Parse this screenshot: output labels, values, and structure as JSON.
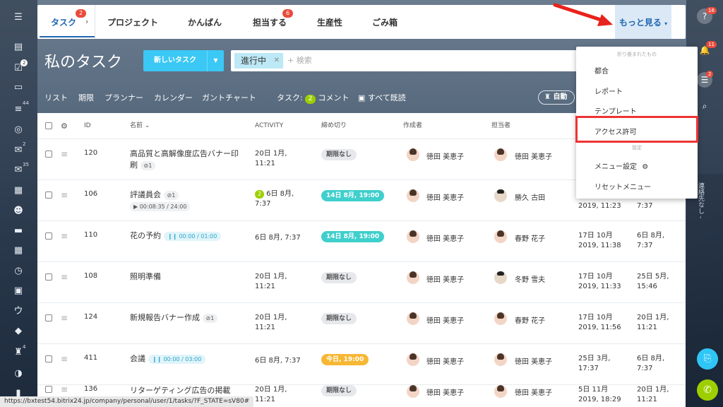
{
  "topnav": {
    "tabs": [
      {
        "label": "タスク",
        "badge": "2"
      },
      {
        "label": "プロジェクト"
      },
      {
        "label": "かんばん"
      },
      {
        "label": "担当する",
        "badge": "6"
      },
      {
        "label": "生産性"
      },
      {
        "label": "ごみ箱"
      }
    ],
    "more": "もっと見る"
  },
  "left_sidebar_badges": {
    "tasks": "2",
    "feed": "44",
    "chat": "2",
    "mail": "35",
    "bot": "4"
  },
  "right_sidebar_badges": {
    "help": "16",
    "notify": "11",
    "messages": "2"
  },
  "right_vertical_text": "連絡先なし -",
  "page_title": "私のタスク",
  "new_task_button": "新しいタスク",
  "filter": {
    "chip": "進行中",
    "placeholder": "+ 検索"
  },
  "views": {
    "items": [
      "リスト",
      "期限",
      "プランナー",
      "カレンダー",
      "ガントチャート"
    ],
    "tasks_label": "タスク:",
    "count": "2",
    "comments": "コメント",
    "read_all": "すべて既読",
    "auto": "自動"
  },
  "table": {
    "headers": {
      "id": "ID",
      "name": "名前",
      "activity": "ACTIVITY",
      "deadline": "締め切り",
      "creator": "作成者",
      "assignee": "担当者"
    },
    "rows": [
      {
        "id": "120",
        "name": "高品質と高解像度広告バナー印刷",
        "attach": "1",
        "act": "",
        "activity": "20日 1月,\n11:21",
        "deadline": "期限なし",
        "dl_style": "none",
        "creator": "徳田 美恵子",
        "assignee": "徳田 美恵子",
        "c1": "",
        "c2": ""
      },
      {
        "id": "106",
        "name": "評議員会",
        "attach": "1",
        "timer": "00:08:35 / 24:00",
        "act": "2",
        "activity": "6日 8月,\n7:37",
        "deadline": "14日 8月, 19:00",
        "dl_style": "teal",
        "creator": "徳田 美恵子",
        "assignee": "勝久 古田",
        "c1": "2019, 11:23",
        "c2": "7:37"
      },
      {
        "id": "110",
        "name": "花の予約",
        "timer": "00:00 / 01:00",
        "act": "",
        "activity": "6日 8月, 7:37",
        "deadline": "14日 8月, 19:00",
        "dl_style": "teal",
        "creator": "徳田 美恵子",
        "assignee": "春野 花子",
        "c1": "17日 10月\n2019, 11:38",
        "c2": "6日 8月,\n7:37"
      },
      {
        "id": "108",
        "name": "照明準備",
        "act": "",
        "activity": "20日 1月,\n11:21",
        "deadline": "期限なし",
        "dl_style": "none",
        "creator": "徳田 美恵子",
        "assignee": "冬野 雪夫",
        "c1": "17日 10月\n2019, 11:33",
        "c2": "25日 5月,\n15:46"
      },
      {
        "id": "124",
        "name": "新規報告バナー作成",
        "attach": "1",
        "act": "",
        "activity": "20日 1月,\n11:21",
        "deadline": "期限なし",
        "dl_style": "none",
        "creator": "徳田 美恵子",
        "assignee": "春野 花子",
        "c1": "17日 10月\n2019, 11:56",
        "c2": "20日 1月,\n11:21"
      },
      {
        "id": "411",
        "name": "会議",
        "timer": "00:00 / 03:00",
        "act": "",
        "activity": "6日 8月, 7:37",
        "deadline": "今日, 19:00",
        "dl_style": "amber",
        "creator": "徳田 美恵子",
        "assignee": "徳田 美恵子",
        "c1": "25日 3月,\n17:37",
        "c2": "6日 8月,\n7:37"
      },
      {
        "id": "136",
        "name": "リターゲティング広告の掲載",
        "act": "",
        "activity": "20日 1月,\n11:21",
        "deadline": "期限なし",
        "dl_style": "none",
        "creator": "徳田 美恵子",
        "assignee": "徳田 美恵子",
        "c1": "5日 11月\n2019, 18:29",
        "c2": "20日 1月,\n11:21"
      }
    ]
  },
  "dropdown": {
    "section1": "折り畳まれたもの",
    "items1": [
      "都合",
      "レポート",
      "テンプレート",
      "アクセス許可"
    ],
    "section2": "設定",
    "items2": [
      "メニュー設定",
      "リセットメニュー"
    ]
  },
  "status_url": "https://bxtest54.bitrix24.jp/company/personal/user/1/tasks/?F_STATE=sV80#",
  "colors": {
    "accent": "#2067b0",
    "highlight": "#e33333",
    "new_task": "#3bc8f5"
  }
}
